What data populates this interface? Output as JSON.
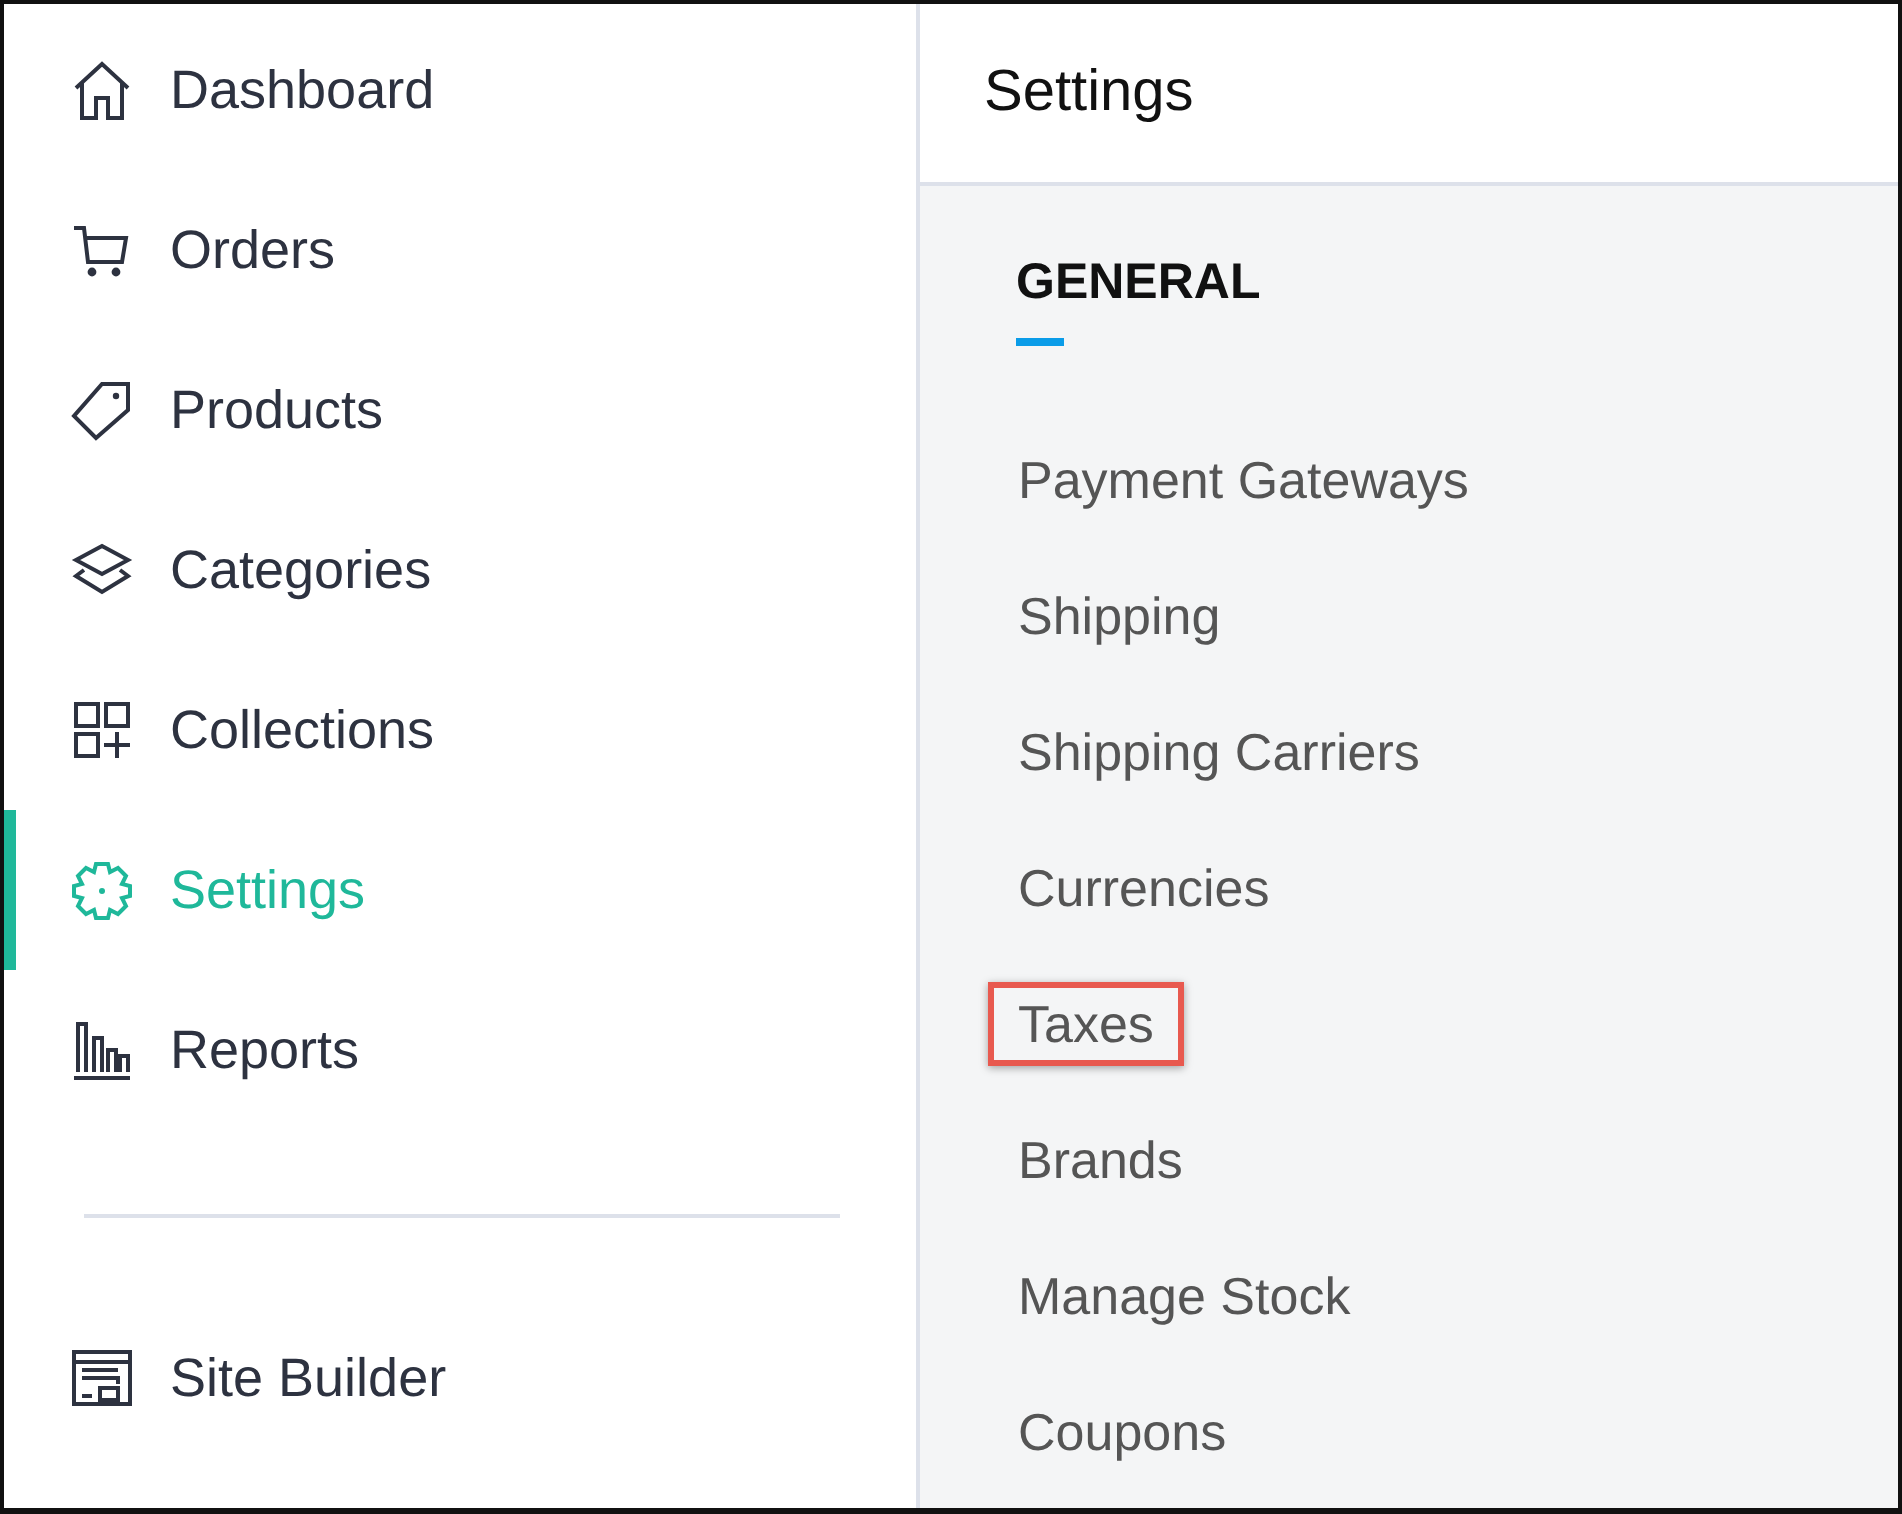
{
  "sidebar": {
    "items": [
      {
        "label": "Dashboard",
        "kind": "home",
        "selected": false
      },
      {
        "label": "Orders",
        "kind": "cart",
        "selected": false
      },
      {
        "label": "Products",
        "kind": "tag",
        "selected": false
      },
      {
        "label": "Categories",
        "kind": "layers",
        "selected": false
      },
      {
        "label": "Collections",
        "kind": "grid",
        "selected": false
      },
      {
        "label": "Settings",
        "kind": "gear",
        "selected": true
      },
      {
        "label": "Reports",
        "kind": "chart",
        "selected": false
      }
    ],
    "secondary_items": [
      {
        "label": "Site Builder",
        "kind": "layout",
        "selected": false
      }
    ]
  },
  "header": {
    "title": "Settings"
  },
  "section": {
    "title": "GENERAL",
    "links": [
      {
        "label": "Payment Gateways",
        "highlighted": false
      },
      {
        "label": "Shipping",
        "highlighted": false
      },
      {
        "label": "Shipping Carriers",
        "highlighted": false
      },
      {
        "label": "Currencies",
        "highlighted": false
      },
      {
        "label": "Taxes",
        "highlighted": true
      },
      {
        "label": "Brands",
        "highlighted": false
      },
      {
        "label": "Manage Stock",
        "highlighted": false
      },
      {
        "label": "Coupons",
        "highlighted": false
      }
    ]
  }
}
